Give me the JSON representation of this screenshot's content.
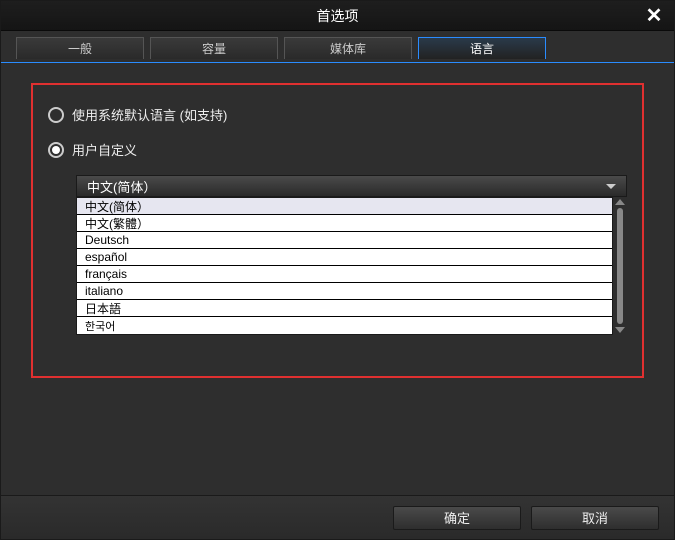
{
  "title": "首选项",
  "tabs": [
    {
      "label": "一般"
    },
    {
      "label": "容量"
    },
    {
      "label": "媒体库"
    },
    {
      "label": "语言"
    }
  ],
  "active_tab_index": 3,
  "radios": {
    "system_default": "使用系统默认语言 (如支持)",
    "user_custom": "用户自定义",
    "selected": "user_custom"
  },
  "dropdown": {
    "selected": "中文(简体）",
    "options": [
      "中文(简体）",
      "中文(繁體）",
      "Deutsch",
      "español",
      "français",
      "italiano",
      "日本語",
      "한국어"
    ],
    "highlighted_index": 0
  },
  "buttons": {
    "ok": "确定",
    "cancel": "取消"
  }
}
